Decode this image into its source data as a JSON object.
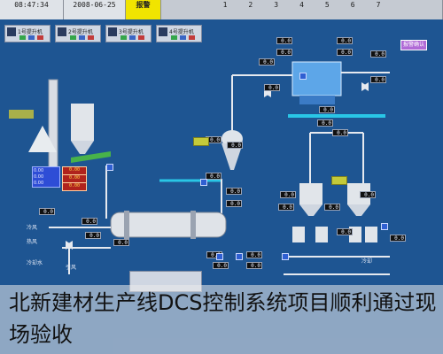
{
  "top_bar": {
    "time": "08:47:34",
    "date": "2008-06-25",
    "alarm_label": "报警",
    "grid_labels": [
      "1",
      "2",
      "3",
      "4",
      "5",
      "6",
      "7"
    ]
  },
  "status_panel": {
    "boxes": [
      "1号提升机",
      "2号提升机",
      "3号提升机",
      "4号提升机"
    ]
  },
  "readouts": {
    "r1": "0.0",
    "r2": "0.0",
    "r3": "0.0",
    "r4": "0.0",
    "r5": "0.0",
    "r6": "0.0",
    "r7": "0.0",
    "r8": "0.0",
    "r9": "0.0",
    "r10": "0.0",
    "r11": "0.0",
    "r12": "0.0",
    "r13": "0.0",
    "r14": "0.0",
    "r15": "0.0",
    "r16": "0.0",
    "r17": "0.0",
    "r18": "0.0",
    "r19": "0.0",
    "r20": "0.0",
    "r21": "0.0",
    "r22": "0.0",
    "r23": "0.0",
    "r24": "0.0",
    "r25": "0.0",
    "r26": "0.0",
    "r27": "0.0",
    "r28": "0.0",
    "r29": "0.0",
    "r30": "0.0"
  },
  "buttons": {
    "magenta": "报警确认"
  },
  "info_boxes": {
    "b1": "0.00",
    "b2": "0.00",
    "b3": "0.00"
  },
  "labels": {
    "l1": "冷风",
    "l2": "热风",
    "l3": "冷却水",
    "l4": "引风",
    "l5": "冷却"
  },
  "caption": {
    "text": "北新建材生产线DCS控制系统项目顺利通过现场验收"
  },
  "colors": {
    "screen_bg": "#1e5592",
    "alarm": "#f1e400",
    "pipe_white": "#e6e9ef",
    "pipe_cyan": "#29c6e6"
  }
}
